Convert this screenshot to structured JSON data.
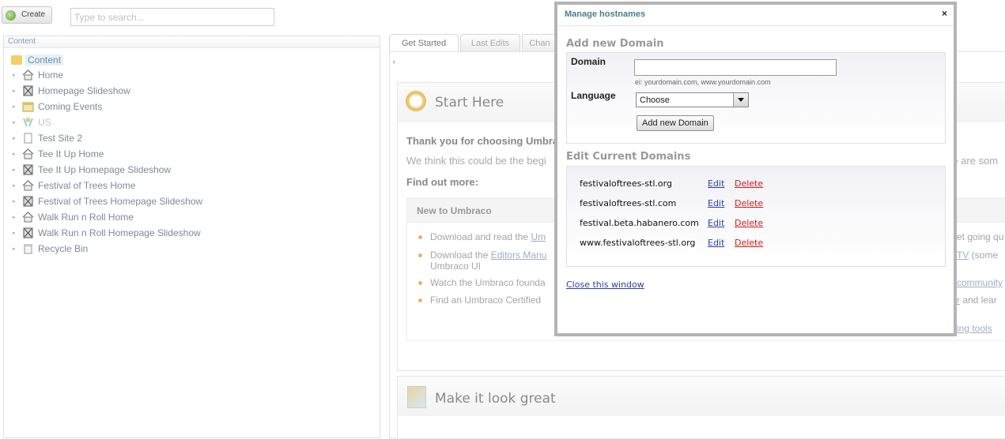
{
  "toolbar": {
    "create_label": "Create",
    "search_placeholder": "Type to search..."
  },
  "tree": {
    "header": "Content",
    "root": "Content",
    "items": [
      {
        "label": "Home",
        "icon": "house-icon"
      },
      {
        "label": "Homepage Slideshow",
        "icon": "slideshow-icon"
      },
      {
        "label": "Coming Events",
        "icon": "calendar-icon"
      },
      {
        "label": "US",
        "icon": "globe-icon"
      },
      {
        "label": "Test Site 2",
        "icon": "document-icon"
      },
      {
        "label": "Tee It Up Home",
        "icon": "house-icon"
      },
      {
        "label": "Tee It Up Homepage Slideshow",
        "icon": "slideshow-icon"
      },
      {
        "label": "Festival of Trees Home",
        "icon": "house-icon"
      },
      {
        "label": "Festival of Trees Homepage Slideshow",
        "icon": "slideshow-icon"
      },
      {
        "label": "Walk Run n Roll Home",
        "icon": "house-icon"
      },
      {
        "label": "Walk Run n Roll Homepage Slideshow",
        "icon": "slideshow-icon"
      },
      {
        "label": "Recycle Bin",
        "icon": "recycle-bin-icon"
      }
    ]
  },
  "tabs": [
    "Get Started",
    "Last Edits",
    "Chan"
  ],
  "dashboard": {
    "start_title": "Start Here",
    "thanks": "Thank you for choosing Umbra",
    "think": "We think this could be the begi",
    "think_end": "re are som",
    "find_out": "Find out more:",
    "new_title": "New to Umbraco",
    "bullets": [
      {
        "pre": "Download and read the ",
        "link": "Um",
        "right_text": "et going qu",
        "right_link": ""
      },
      {
        "pre": "Download the ",
        "link": "Editors Manu",
        "right_text": " (some",
        "right_link": "TV",
        "line2": "Umbraco UI"
      },
      {
        "pre": "Watch the Umbraco founda",
        "link": "",
        "right_text": "",
        "right_link": "community"
      },
      {
        "pre": "Find an Umbraco Certified",
        "link": "",
        "right_text": " and lear",
        "right_link": "r"
      }
    ],
    "extra_link": "ing tools",
    "look_title": "Make it look great"
  },
  "modal": {
    "title": "Manage hostnames",
    "close": "×",
    "add_title": "Add new Domain",
    "domain_label": "Domain",
    "domain_value": "",
    "hint": "ei: yourdomain.com, www.yourdomain.com",
    "language_label": "Language",
    "language_value": "Choose",
    "add_button": "Add new Domain",
    "edit_title": "Edit Current Domains",
    "edit_label": "Edit",
    "delete_label": "Delete",
    "domains": [
      "festivaloftrees-stl.org",
      "festivaloftrees-stl.com",
      "festival.beta.habanero.com",
      "www.festivaloftrees-stl.org"
    ],
    "close_link": "Close this window"
  }
}
